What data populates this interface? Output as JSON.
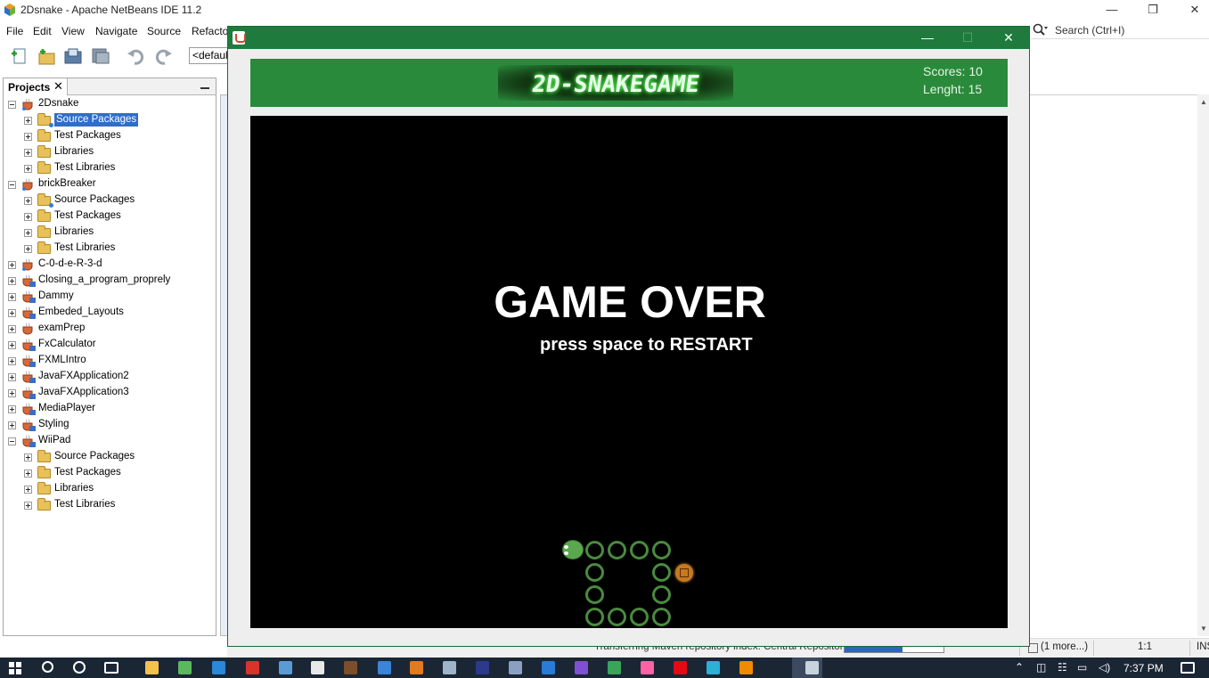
{
  "ide": {
    "title": "2Dsnake - Apache NetBeans IDE 11.2",
    "window_controls": {
      "minimize": "—",
      "restore": "❐",
      "close": "✕"
    },
    "menu": [
      "File",
      "Edit",
      "View",
      "Navigate",
      "Source",
      "Refacto"
    ],
    "config_combo": "<default",
    "search_placeholder": "Search (Ctrl+I)"
  },
  "projects_panel": {
    "tab_label": "Projects",
    "close_glyph": "✕",
    "tree": [
      {
        "label": "2Dsnake",
        "level": 0,
        "icon": "maven-project-icon",
        "expander": "minus"
      },
      {
        "label": "Source Packages",
        "level": 1,
        "icon": "source-packages-folder-icon",
        "expander": "plus",
        "selected": true
      },
      {
        "label": "Test Packages",
        "level": 1,
        "icon": "test-packages-folder-icon",
        "expander": "plus"
      },
      {
        "label": "Libraries",
        "level": 1,
        "icon": "libraries-folder-icon",
        "expander": "plus"
      },
      {
        "label": "Test Libraries",
        "level": 1,
        "icon": "test-libraries-folder-icon",
        "expander": "plus"
      },
      {
        "label": "brickBreaker",
        "level": 0,
        "icon": "maven-project-icon",
        "expander": "minus"
      },
      {
        "label": "Source Packages",
        "level": 1,
        "icon": "source-packages-folder-icon",
        "expander": "plus"
      },
      {
        "label": "Test Packages",
        "level": 1,
        "icon": "test-packages-folder-icon",
        "expander": "plus"
      },
      {
        "label": "Libraries",
        "level": 1,
        "icon": "libraries-folder-icon",
        "expander": "plus"
      },
      {
        "label": "Test Libraries",
        "level": 1,
        "icon": "test-libraries-folder-icon",
        "expander": "plus"
      },
      {
        "label": "C-0-d-e-R-3-d",
        "level": 0,
        "icon": "maven-project-icon",
        "expander": "plus"
      },
      {
        "label": "Closing_a_program_proprely",
        "level": 0,
        "icon": "javafx-project-icon",
        "expander": "plus"
      },
      {
        "label": "Dammy",
        "level": 0,
        "icon": "javafx-project-icon",
        "expander": "plus"
      },
      {
        "label": "Embeded_Layouts",
        "level": 0,
        "icon": "javafx-project-icon",
        "expander": "plus"
      },
      {
        "label": "examPrep",
        "level": 0,
        "icon": "java-project-icon",
        "expander": "plus"
      },
      {
        "label": "FxCalculator",
        "level": 0,
        "icon": "javafx-project-icon",
        "expander": "plus"
      },
      {
        "label": "FXMLIntro",
        "level": 0,
        "icon": "javafx-project-icon",
        "expander": "plus"
      },
      {
        "label": "JavaFXApplication2",
        "level": 0,
        "icon": "javafx-project-icon",
        "expander": "plus"
      },
      {
        "label": "JavaFXApplication3",
        "level": 0,
        "icon": "javafx-project-icon",
        "expander": "plus"
      },
      {
        "label": "MediaPlayer",
        "level": 0,
        "icon": "javafx-project-icon",
        "expander": "plus"
      },
      {
        "label": "Styling",
        "level": 0,
        "icon": "javafx-project-icon",
        "expander": "plus"
      },
      {
        "label": "WiiPad",
        "level": 0,
        "icon": "javafx-project-icon",
        "expander": "minus"
      },
      {
        "label": "Source Packages",
        "level": 1,
        "icon": "source-packages-folder-icon",
        "expander": "plus"
      },
      {
        "label": "Test Packages",
        "level": 1,
        "icon": "test-packages-folder-icon",
        "expander": "plus"
      },
      {
        "label": "Libraries",
        "level": 1,
        "icon": "libraries-folder-icon",
        "expander": "plus"
      },
      {
        "label": "Test Libraries",
        "level": 1,
        "icon": "test-libraries-folder-icon",
        "expander": "plus"
      }
    ]
  },
  "status_bar": {
    "task_text": "Transferring Maven repository index: Central Repository",
    "progress_percent": 59,
    "progress_label": "59%",
    "more": "(1 more...)",
    "caret_position": "1:1",
    "insert_mode": "INS"
  },
  "game_window": {
    "controls": {
      "minimize": "—",
      "maximize": "☐",
      "close": "✕"
    },
    "logo_text": "2D-SNAKEGAME",
    "score_line": "Scores: 10",
    "length_line": "Lenght: 15",
    "game_over_text": "GAME OVER",
    "restart_hint": "press space to RESTART",
    "colors": {
      "header": "#2a8a3b",
      "titlebar": "#1f7a3d",
      "board": "#000000",
      "snake_ring": "#4a8a3f",
      "snake_head": "#5aa84d",
      "food": "#c67a1f"
    }
  },
  "taskbar": {
    "clock": "7:37 PM",
    "pinned_icons": [
      "start-icon",
      "search-icon",
      "cortana-icon",
      "task-view-icon",
      "file-explorer-icon",
      "utorrent-icon",
      "mail-icon",
      "acrobat-icon",
      "netbeans-icon",
      "chrome-icon",
      "game-icon",
      "photos-icon",
      "pdf-icon",
      "ms-paint-icon",
      "photoshop-icon",
      "r-icon",
      "vscode-icon",
      "app-icon",
      "git-icon",
      "xd-icon",
      "netflix-icon",
      "vpn-icon",
      "vlc-icon",
      "java-app-icon"
    ]
  }
}
